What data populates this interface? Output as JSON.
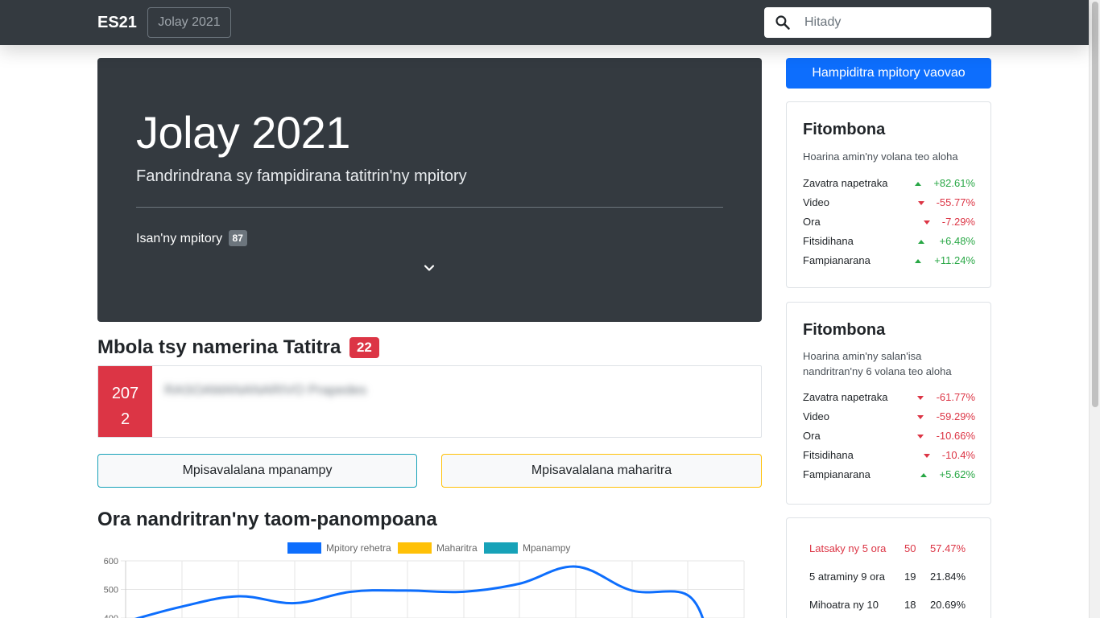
{
  "navbar": {
    "brand": "ES21",
    "month_button": "Jolay 2021",
    "search_placeholder": "Hitady"
  },
  "hero": {
    "title": "Jolay 2021",
    "subtitle": "Fandrindrana sy fampidirana tatitrin'ny mpitory",
    "count_label": "Isan'ny mpitory",
    "count_value": "87"
  },
  "pending": {
    "title": "Mbola tsy namerina Tatitra",
    "count": "22",
    "item_id_line1": "207",
    "item_id_line2": "2",
    "item_text": "RASOAMANANARIVO Prapedes"
  },
  "buttons": {
    "assistant": "Mpisavalalana mpanampy",
    "expert": "Mpisavalalana maharitra",
    "add_new": "Hampiditra mpitory vaovao"
  },
  "chart_section": {
    "title": "Ora nandritran'ny taom-panompoana"
  },
  "chart_data": {
    "type": "line",
    "series": [
      {
        "name": "Mpitory rehetra",
        "color": "#0d6efd",
        "values": [
          395,
          440,
          476,
          452,
          492,
          496,
          492,
          520,
          580,
          496,
          480,
          330
        ]
      },
      {
        "name": "Maharitra",
        "color": "#ffc107",
        "values": []
      },
      {
        "name": "Mpanampy",
        "color": "#17a2b8",
        "values": []
      }
    ],
    "y_ticks": [
      "600",
      "500",
      "400"
    ],
    "ylim": [
      400,
      600
    ],
    "grid": true,
    "legend": "top"
  },
  "stats_month": {
    "title": "Fitombona",
    "subtitle": "Hoarina amin'ny volana teo aloha",
    "rows": [
      {
        "label": "Zavatra napetraka",
        "value": "+82.61%",
        "dir": "up"
      },
      {
        "label": "Video",
        "value": "-55.77%",
        "dir": "down"
      },
      {
        "label": "Ora",
        "value": "-7.29%",
        "dir": "down"
      },
      {
        "label": "Fitsidihana",
        "value": "+6.48%",
        "dir": "up"
      },
      {
        "label": "Fampianarana",
        "value": "+11.24%",
        "dir": "up"
      }
    ]
  },
  "stats_avg": {
    "title": "Fitombona",
    "subtitle": "Hoarina amin'ny salan'isa nandritran'ny 6 volana teo aloha",
    "rows": [
      {
        "label": "Zavatra napetraka",
        "value": "-61.77%",
        "dir": "down"
      },
      {
        "label": "Video",
        "value": "-59.29%",
        "dir": "down"
      },
      {
        "label": "Ora",
        "value": "-10.66%",
        "dir": "down"
      },
      {
        "label": "Fitsidihana",
        "value": "-10.4%",
        "dir": "down"
      },
      {
        "label": "Fampianarana",
        "value": "+5.62%",
        "dir": "up"
      }
    ]
  },
  "hours_distribution": {
    "rows": [
      {
        "label": "Latsaky ny 5 ora",
        "count": "50",
        "percent": "57.47%",
        "alert": true
      },
      {
        "label": "5 atraminy 9 ora",
        "count": "19",
        "percent": "21.84%",
        "alert": false
      },
      {
        "label": "Mihoatra ny 10",
        "count": "18",
        "percent": "20.69%",
        "alert": false
      }
    ]
  },
  "colors": {
    "dark": "#343a40",
    "primary": "#0d6efd",
    "danger": "#dc3545",
    "success": "#28a745",
    "info": "#17a2b8",
    "warning": "#ffc107"
  },
  "icons": {
    "search": "search-icon",
    "chevron": "chevron-down-icon",
    "up": "caret-up-icon",
    "down": "caret-down-icon"
  }
}
